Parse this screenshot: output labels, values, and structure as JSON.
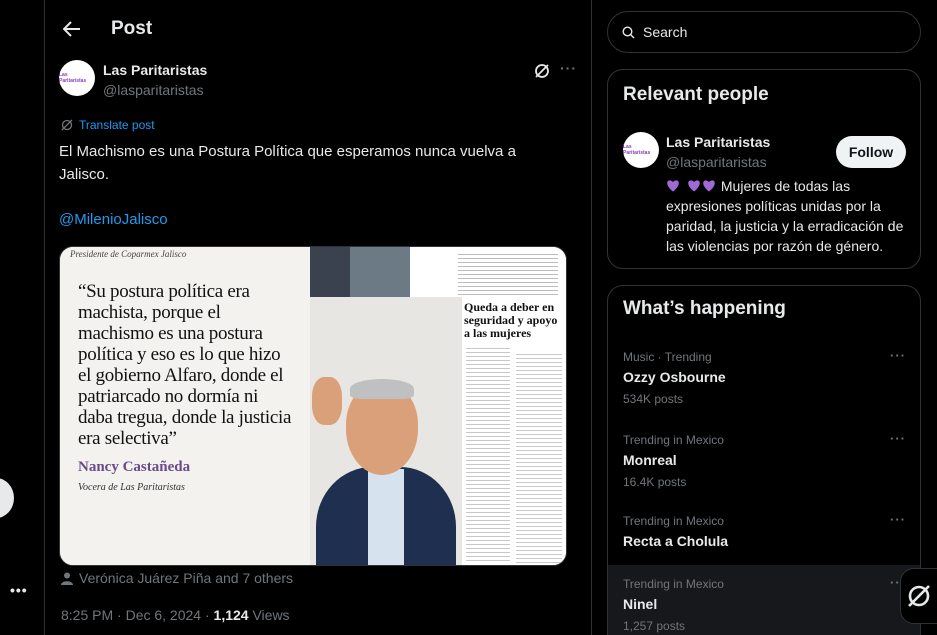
{
  "header": {
    "title": "Post",
    "back_icon": "arrow-left-icon"
  },
  "post": {
    "author_name": "Las Paritaristas",
    "author_handle": "@lasparitaristas",
    "avatar_text": "Las Paritaristas",
    "translate_label": "Translate post",
    "text": "El Machismo es una Postura Política que esperamos nunca vuelva a Jalisco.",
    "mention": "@MilenioJalisco",
    "media": {
      "caption_top": "Presidente de Coparmex Jalisco",
      "quote": "“Su postura política era machista, porque el machismo es una postura política y eso es lo que hizo el gobierno Alfaro, donde el patriarcado no dormía ni daba tregua, donde la justicia era selectiva”",
      "byline": "Nancy Castañeda",
      "subbyline": "Vocera de Las Paritaristas",
      "headline": "Queda a deber en seguridad y apoyo a las mujeres"
    },
    "liked_by": "Verónica Juárez Piña and 7 others",
    "timestamp": "8:25 PM · Dec 6, 2024 · ",
    "views_count": "1,124",
    "views_label": " Views"
  },
  "sidebar": {
    "search_placeholder": "Search",
    "relevant_people": {
      "title": "Relevant people",
      "name": "Las Paritaristas",
      "handle": "@lasparitaristas",
      "follow_label": "Follow",
      "bio": "Mujeres de todas las expresiones políticas unidas por la paridad, la justicia y la erradicación de las violencias por razón de género."
    },
    "whats_happening": {
      "title": "What’s happening",
      "trends": [
        {
          "meta": "Music · Trending",
          "name": "Ozzy Osbourne",
          "posts": "534K posts"
        },
        {
          "meta": "Trending in Mexico",
          "name": "Monreal",
          "posts": "16.4K posts"
        },
        {
          "meta": "Trending in Mexico",
          "name": "Recta a Cholula",
          "posts": ""
        },
        {
          "meta": "Trending in Mexico",
          "name": "Ninel",
          "posts": "1,257 posts"
        }
      ]
    }
  },
  "colors": {
    "accent": "#1d9bf0",
    "heart": "#a06ad6",
    "muted": "#71767b",
    "text": "#e7e9ea"
  }
}
